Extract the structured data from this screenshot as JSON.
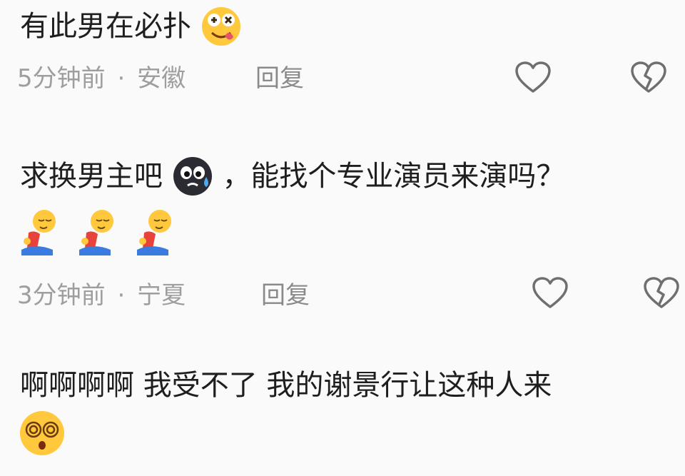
{
  "comments": [
    {
      "text": "有此男在必扑",
      "emoji": "drooling-face-emoji",
      "time": "5分钟前",
      "location": "安徽",
      "reply_label": "回复",
      "like_icon": "heart-icon",
      "dislike_icon": "broken-heart-icon"
    },
    {
      "text_before": "求换男主吧",
      "text_after": "，能找个专业演员来演吗？",
      "inline_emoji": "sweating-dark-face-emoji",
      "trailing_emojis": [
        "kneeling-person-emoji",
        "kneeling-person-emoji",
        "kneeling-person-emoji"
      ],
      "time": "3分钟前",
      "location": "宁夏",
      "reply_label": "回复",
      "like_icon": "heart-icon",
      "dislike_icon": "broken-heart-icon"
    },
    {
      "text": "啊啊啊啊 我受不了 我的谢景行让这种人来",
      "trailing_emoji": "dizzy-face-emoji"
    }
  ],
  "separator": "·",
  "colors": {
    "background": "#fafafa",
    "text": "#1e1e1e",
    "meta": "#9e9e9e",
    "icon_stroke": "#6f6f6f",
    "emoji_yellow": "#ffc83d"
  }
}
